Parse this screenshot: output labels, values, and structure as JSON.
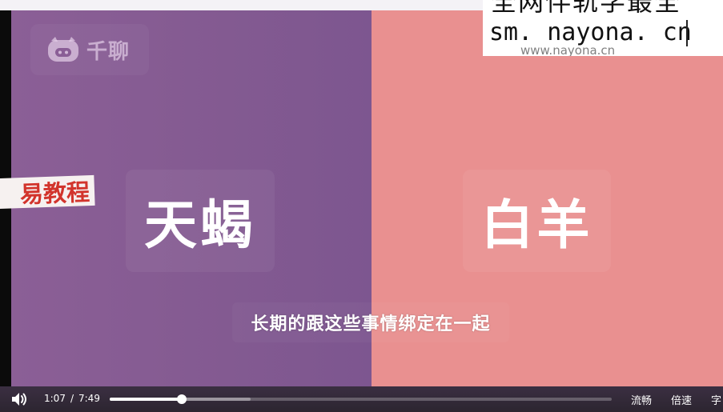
{
  "video": {
    "logo_text": "千聊",
    "banner_text": "易教程",
    "title_left": "天蝎",
    "title_right": "白羊",
    "subtitle": "长期的跟这些事情绑定在一起",
    "colors": {
      "left_panel": "#875c94",
      "right_panel": "#e99090",
      "banner_text": "#d2342c"
    }
  },
  "watermark": {
    "line_top": "全网伴轨学最全",
    "url": "sm. nayona. cn",
    "obscured_text": "www.nayona.cn"
  },
  "controls": {
    "volume_icon": "volume-icon",
    "current_time": "1:07",
    "separator": "/",
    "duration": "7:49",
    "progress_fraction": 0.143,
    "buffered_fraction": 0.28,
    "quality_label": "流畅",
    "speed_label": "倍速",
    "subtitle_label": "字"
  }
}
